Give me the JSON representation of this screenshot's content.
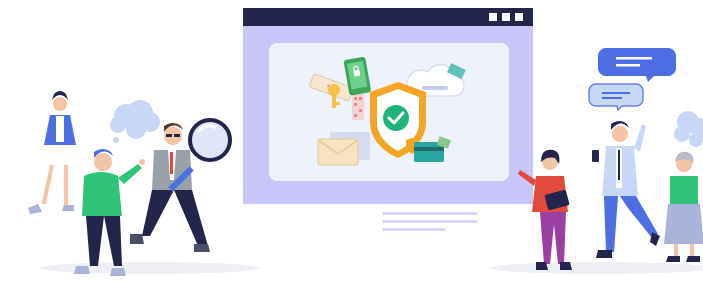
{
  "colors": {
    "window_titlebar": "#23264a",
    "window_body": "#c7c6f6",
    "window_inner": "#eef2fb",
    "accent_blue": "#4e6fe3",
    "shield_orange": "#f5a524",
    "check_green": "#1fb37a",
    "bubble_light": "#c9d7f7",
    "caption_lines": "#d7d5f7"
  },
  "window": {
    "controls": [
      "minimize-icon",
      "maximize-icon",
      "close-icon"
    ]
  },
  "icons": [
    "shield-check-icon",
    "password-icon",
    "key-icon",
    "phone-lock-icon",
    "cloud-icon",
    "envelope-icon",
    "credit-card-icon",
    "magnifier-icon",
    "chat-bubble-icon",
    "thought-bubble-icon"
  ]
}
